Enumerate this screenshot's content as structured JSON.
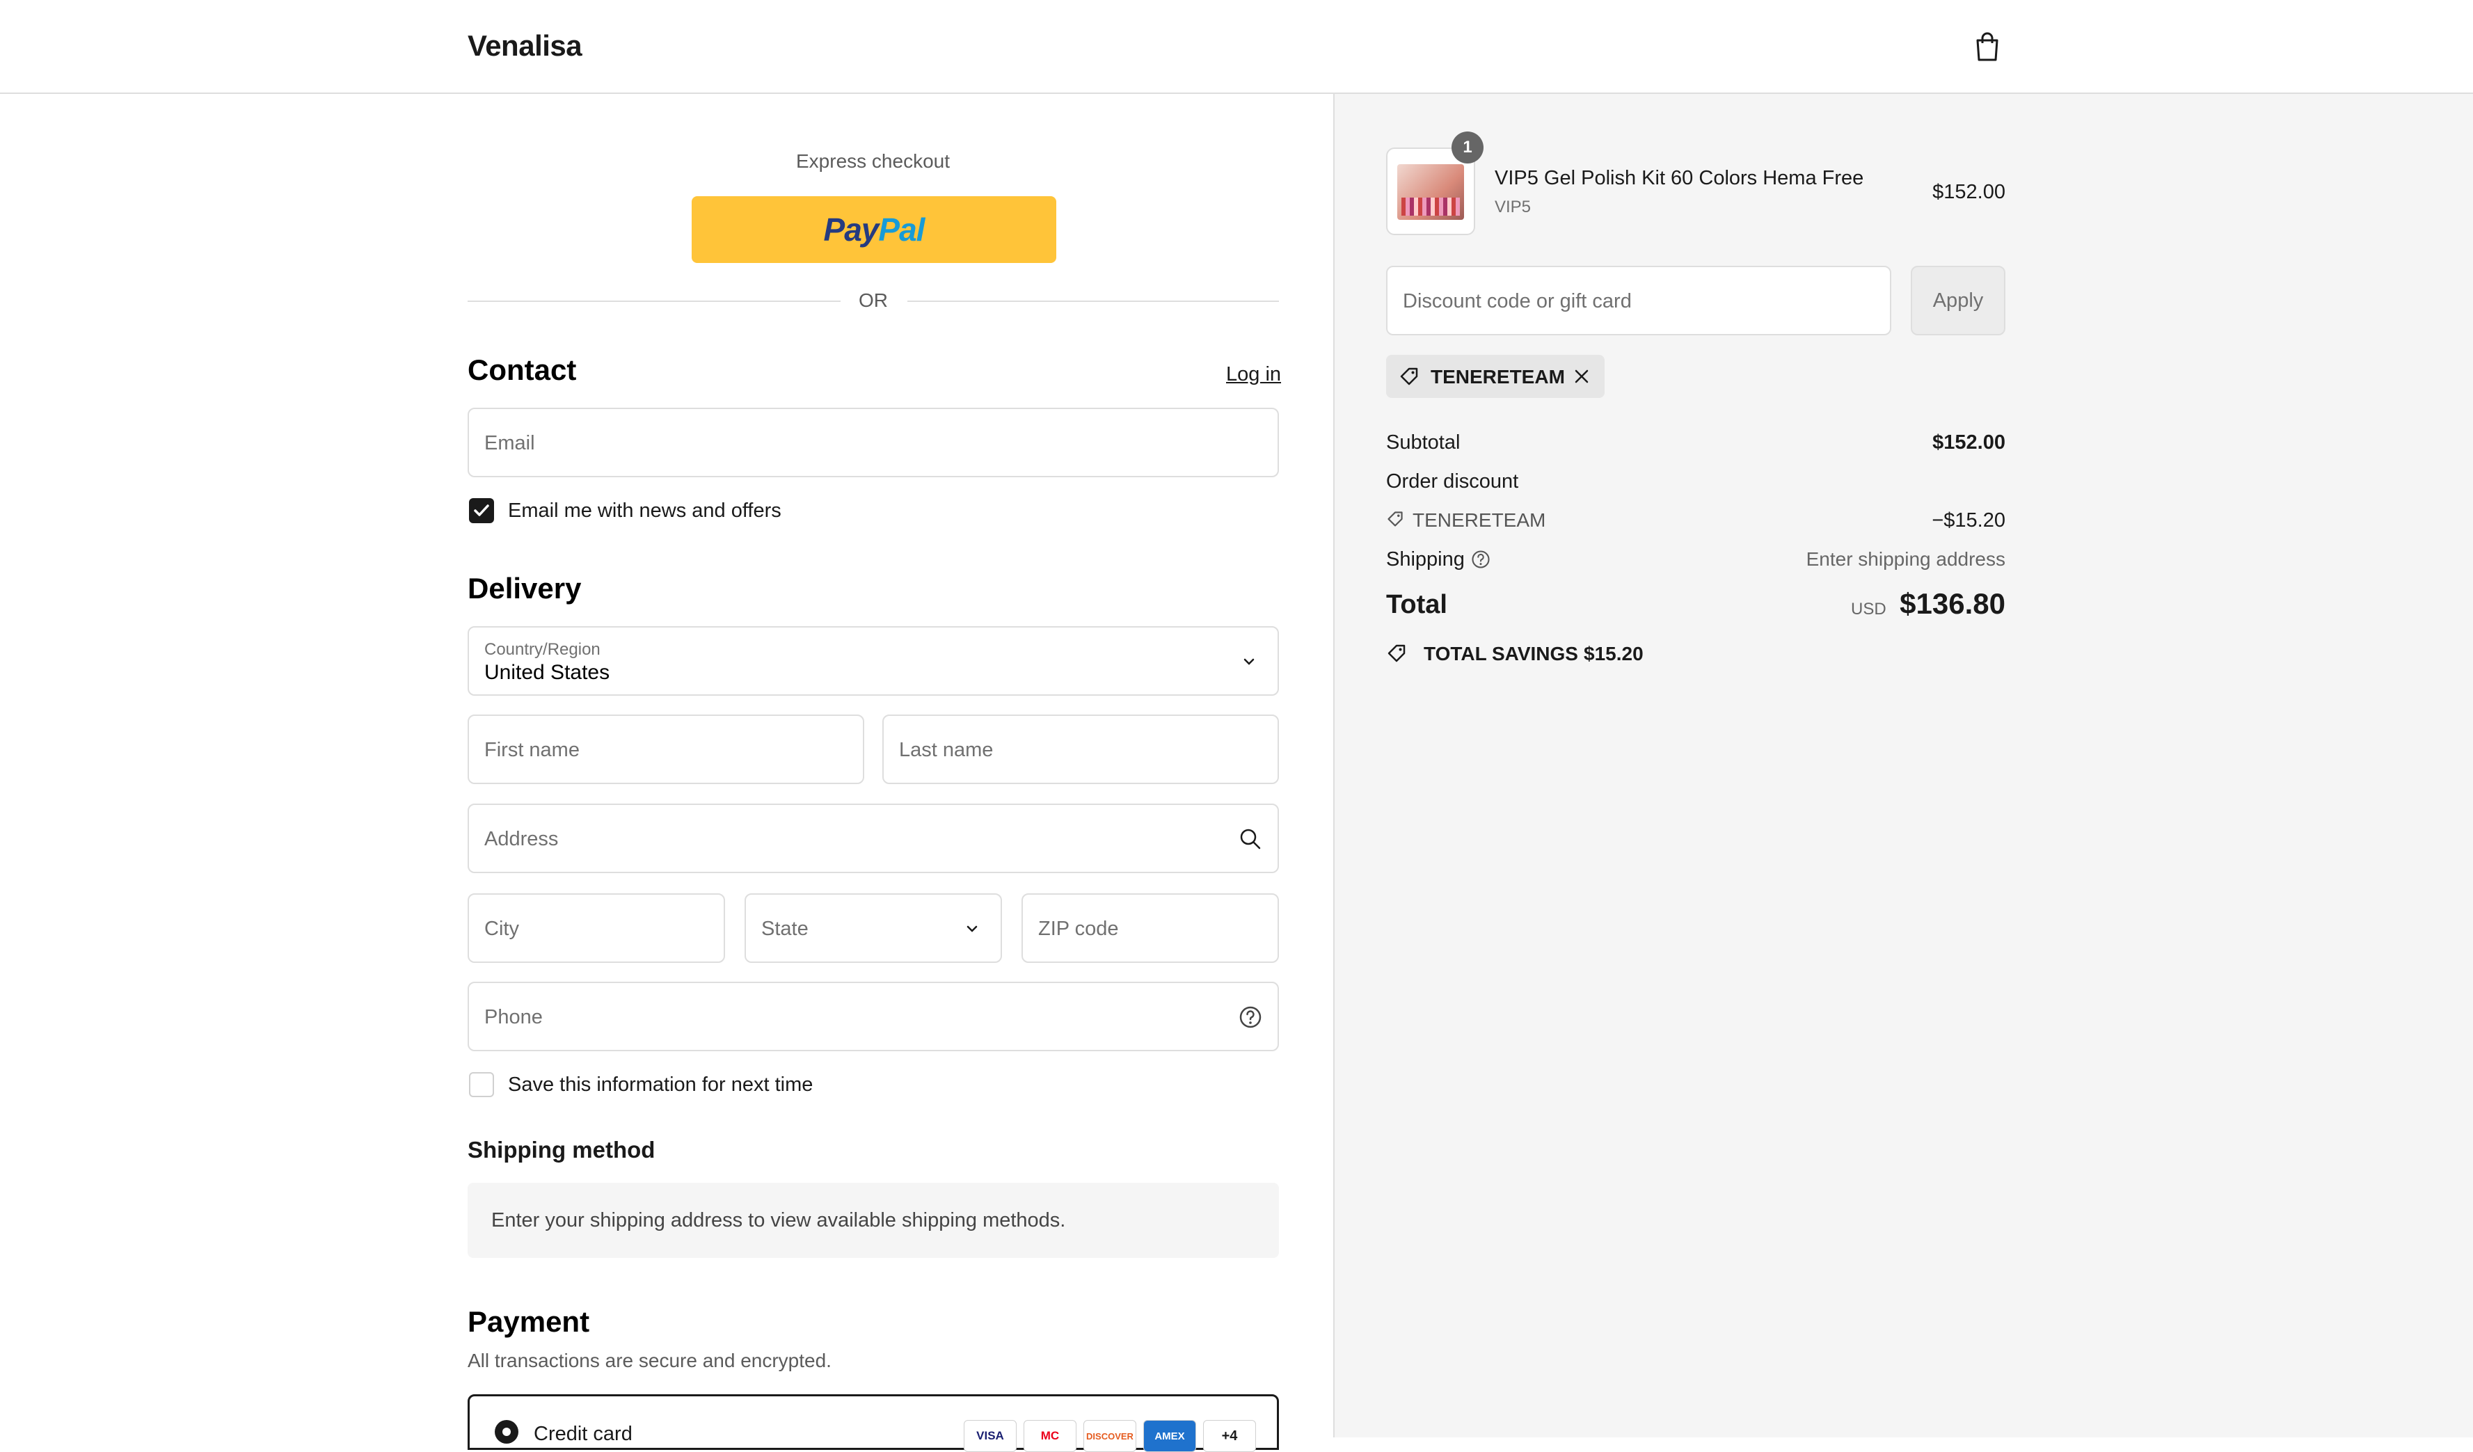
{
  "header": {
    "brand": "Venalisa"
  },
  "express": {
    "label": "Express checkout",
    "paypal_pay": "Pay",
    "paypal_pal": "Pal",
    "or": "OR"
  },
  "contact": {
    "title": "Contact",
    "login": "Log in",
    "email_placeholder": "Email",
    "newsletter_label": "Email me with news and offers",
    "newsletter_checked": true
  },
  "delivery": {
    "title": "Delivery",
    "country_label": "Country/Region",
    "country_value": "United States",
    "first_name": "First name",
    "last_name": "Last name",
    "address": "Address",
    "city": "City",
    "state": "State",
    "zip": "ZIP code",
    "phone": "Phone",
    "save_info": "Save this information for next time"
  },
  "shipping_method": {
    "title": "Shipping method",
    "message": "Enter your shipping address to view available shipping methods."
  },
  "payment": {
    "title": "Payment",
    "subtitle": "All transactions are secure and encrypted.",
    "method_label": "Credit card",
    "cards": [
      "VISA",
      "MC",
      "DISCOVER",
      "AMEX",
      "+4"
    ]
  },
  "summary": {
    "item": {
      "name": "VIP5 Gel Polish Kit 60 Colors Hema Free",
      "variant": "VIP5",
      "price": "$152.00",
      "quantity": "1"
    },
    "discount_placeholder": "Discount code or gift card",
    "apply": "Apply",
    "applied_code": "TENERETEAM",
    "subtotal_label": "Subtotal",
    "subtotal_value": "$152.00",
    "order_discount_label": "Order discount",
    "discount_code": "TENERETEAM",
    "discount_value": "−$15.20",
    "shipping_label": "Shipping",
    "shipping_value": "Enter shipping address",
    "total_label": "Total",
    "currency": "USD",
    "total_value": "$136.80",
    "savings_label": "TOTAL SAVINGS",
    "savings_value": "$15.20"
  }
}
